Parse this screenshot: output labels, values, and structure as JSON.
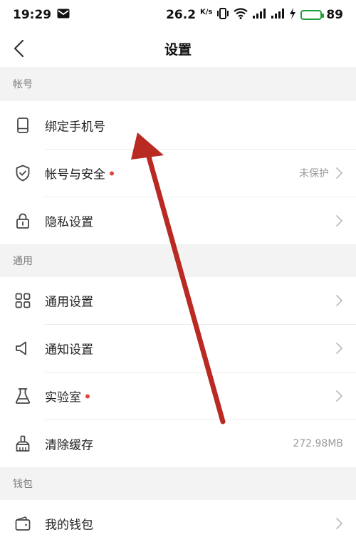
{
  "status_bar": {
    "time": "19:29",
    "net_speed": "26.2",
    "net_unit": "K/s",
    "battery_level": "89",
    "icons": [
      "mail-icon",
      "vibrate-icon",
      "wifi-icon",
      "signal-icon",
      "signal-icon",
      "charging-icon",
      "battery-icon"
    ]
  },
  "navbar": {
    "title": "设置",
    "back_icon": "chevron-left-icon"
  },
  "sections": {
    "account": "帐号",
    "general": "通用",
    "wallet": "钱包"
  },
  "rows": {
    "bind_phone": {
      "label": "绑定手机号",
      "icon": "phone-icon"
    },
    "account_security": {
      "label": "帐号与安全",
      "value": "未保护",
      "badge": "red-dot",
      "icon": "shield-check-icon"
    },
    "privacy": {
      "label": "隐私设置",
      "icon": "lock-icon"
    },
    "general_settings": {
      "label": "通用设置",
      "icon": "grid-icon"
    },
    "notifications": {
      "label": "通知设置",
      "icon": "speaker-icon"
    },
    "lab": {
      "label": "实验室",
      "badge": "red-dot",
      "icon": "flask-icon"
    },
    "clear_cache": {
      "label": "清除缓存",
      "value": "272.98MB",
      "icon": "broom-icon"
    },
    "my_wallet": {
      "label": "我的钱包",
      "icon": "wallet-icon"
    }
  },
  "colors": {
    "annotation_arrow": "#b82a22",
    "badge": "#e0463b",
    "battery": "#2bbf4b",
    "section_bg": "#f3f3f3"
  },
  "annotation": {
    "type": "arrow",
    "points_to": "bind_phone"
  }
}
